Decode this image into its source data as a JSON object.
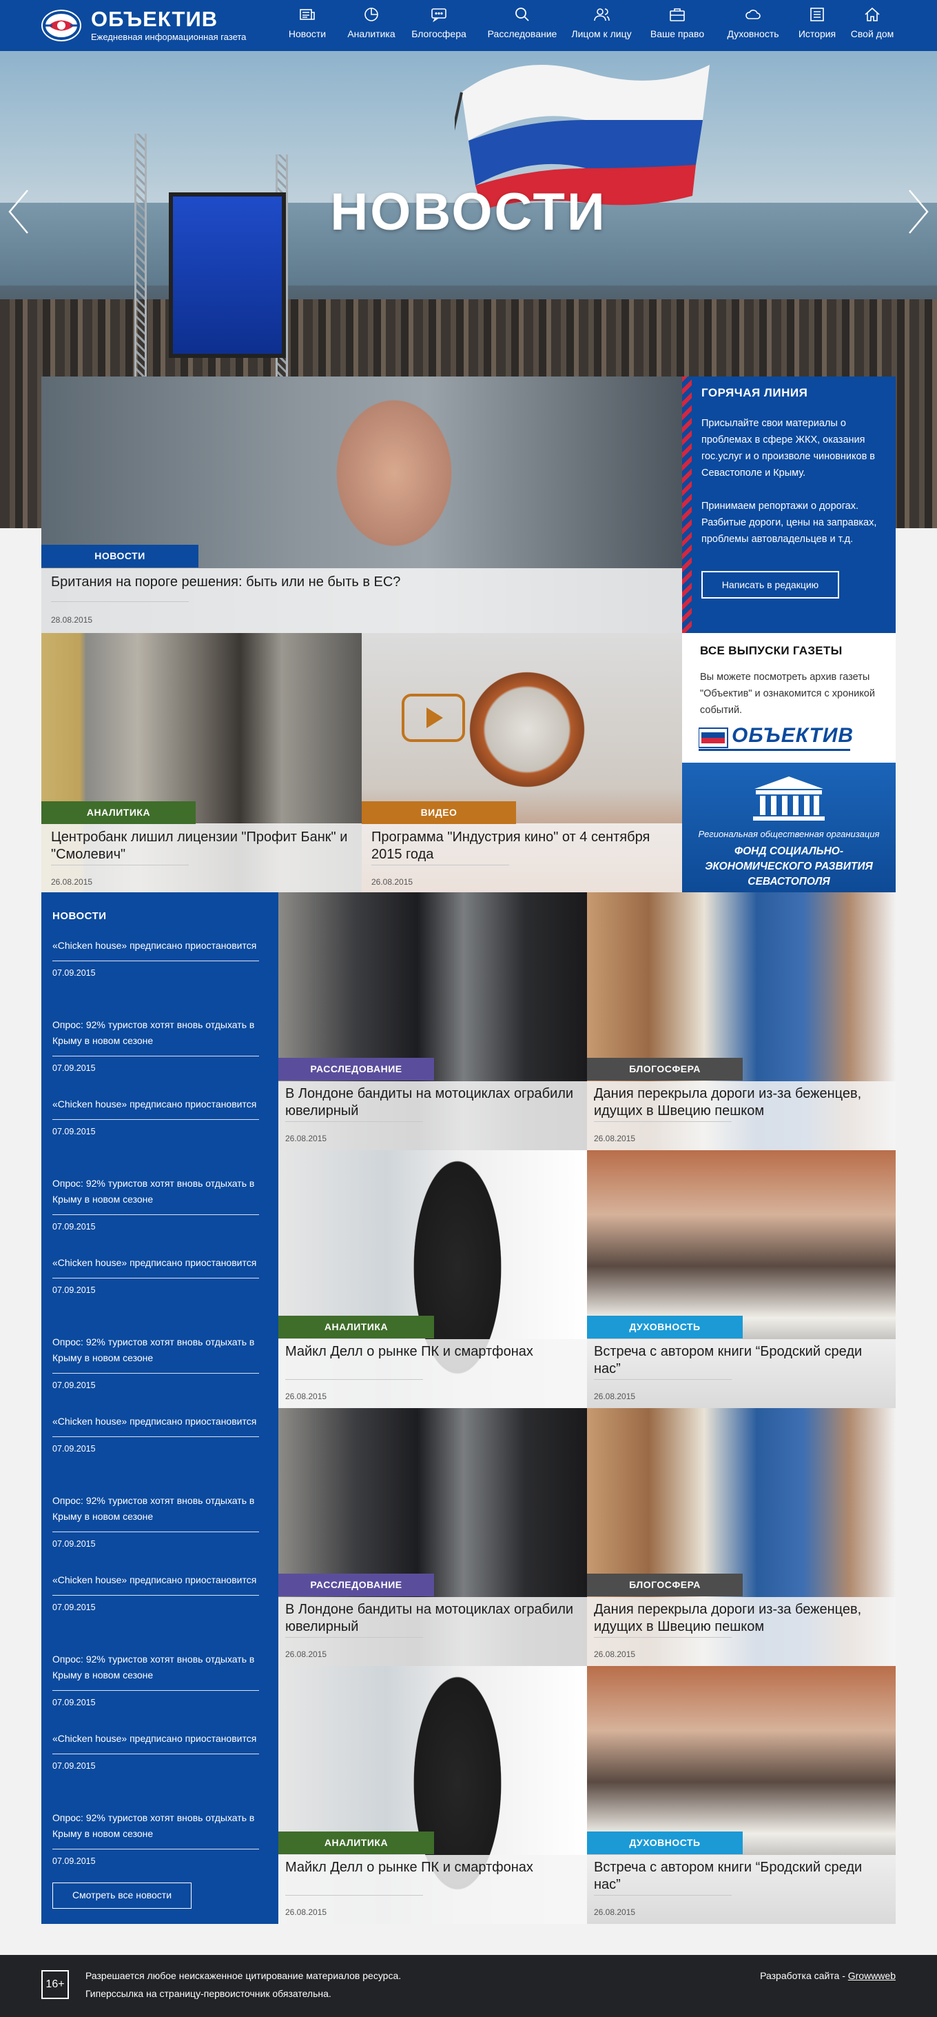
{
  "header": {
    "logo_name": "ОБЪЕКТИВ",
    "logo_tagline": "Ежедневная информационная газета",
    "nav": [
      {
        "label": "Новости",
        "icon": "news-icon"
      },
      {
        "label": "Аналитика",
        "icon": "pie-chart-icon"
      },
      {
        "label": "Блогосфера",
        "icon": "chat-icon"
      },
      {
        "label": "Расследование",
        "icon": "search-icon"
      },
      {
        "label": "Лицом к лицу",
        "icon": "users-icon"
      },
      {
        "label": "Ваше право",
        "icon": "briefcase-icon"
      },
      {
        "label": "Духовность",
        "icon": "cloud-icon"
      },
      {
        "label": "История",
        "icon": "book-icon"
      },
      {
        "label": "Свой дом",
        "icon": "home-icon"
      }
    ]
  },
  "hero": {
    "title": "НОВОСТИ"
  },
  "featured": {
    "badge": "НОВОСТИ",
    "title": "Британия на пороге решения: быть или не быть в ЕС?",
    "date": "28.08.2015"
  },
  "hotline": {
    "title": "ГОРЯЧАЯ ЛИНИЯ",
    "text1": "Присылайте свои материалы о проблемах в сфере ЖКХ, оказания гос.услуг и о произволе чиновников в Севастополе и Крыму.",
    "text2": "Принимаем репортажи о дорогах. Разбитые дороги, цены на заправках, проблемы автовладельцев и т.д.",
    "button": "Написать в редакцию"
  },
  "archive": {
    "title": "ВСЕ ВЫПУСКИ ГАЗЕТЫ",
    "text": "Вы можете посмотреть архив газеты \"Объектив\" и ознакомится с хроникой событий.",
    "logo_text": "ОБЪЕКТИВ"
  },
  "fond": {
    "line1": "Региональная общественная организация",
    "line2": "ФОНД СОЦИАЛЬНО-ЭКОНОМИЧЕСКОГО РАЗВИТИЯ СЕВАСТОПОЛЯ"
  },
  "row2": [
    {
      "badge": "АНАЛИТИКА",
      "title": "Центробанк лишил лицензии \"Профит Банк\" и \"Смолевич\"",
      "date": "26.08.2015"
    },
    {
      "badge": "ВИДЕО",
      "title": "Программа \"Индустрия кино\" от 4 сентября 2015 года",
      "date": "26.08.2015"
    }
  ],
  "grid": [
    {
      "badge": "РАССЛЕДОВАНИЕ",
      "title": "В Лондоне бандиты на мотоциклах ограбили ювелирный",
      "date": "26.08.2015"
    },
    {
      "badge": "БЛОГОСФЕРА",
      "title": "Дания перекрыла дороги из-за беженцев, идущих в Швецию пешком",
      "date": "26.08.2015"
    },
    {
      "badge": "АНАЛИТИКА",
      "title": "Майкл Делл о рынке ПК и смартфонах",
      "date": "26.08.2015"
    },
    {
      "badge": "ДУХОВНОСТЬ",
      "title": "Встреча с автором книги “Бродский среди нас”",
      "date": "26.08.2015"
    },
    {
      "badge": "РАССЛЕДОВАНИЕ",
      "title": "В Лондоне бандиты на мотоциклах ограбили ювелирный",
      "date": "26.08.2015"
    },
    {
      "badge": "БЛОГОСФЕРА",
      "title": "Дания перекрыла дороги из-за беженцев, идущих в Швецию пешком",
      "date": "26.08.2015"
    },
    {
      "badge": "АНАЛИТИКА",
      "title": "Майкл Делл о рынке ПК и смартфонах",
      "date": "26.08.2015"
    },
    {
      "badge": "ДУХОВНОСТЬ",
      "title": "Встреча с автором книги “Бродский среди нас”",
      "date": "26.08.2015"
    }
  ],
  "newslist": {
    "title": "НОВОСТИ",
    "items": [
      {
        "title": "«Chicken house» предписано приостановится",
        "date": "07.09.2015"
      },
      {
        "title": "Опрос: 92% туристов хотят вновь отдыхать в Крыму в новом сезоне",
        "date": "07.09.2015"
      },
      {
        "title": "«Chicken house» предписано приостановится",
        "date": "07.09.2015"
      },
      {
        "title": "Опрос: 92% туристов хотят вновь отдыхать в Крыму в новом сезоне",
        "date": "07.09.2015"
      },
      {
        "title": "«Chicken house» предписано приостановится",
        "date": "07.09.2015"
      },
      {
        "title": "Опрос: 92% туристов хотят вновь отдыхать в Крыму в новом сезоне",
        "date": "07.09.2015"
      },
      {
        "title": "«Chicken house» предписано приостановится",
        "date": "07.09.2015"
      },
      {
        "title": "Опрос: 92% туристов хотят вновь отдыхать в Крыму в новом сезоне",
        "date": "07.09.2015"
      },
      {
        "title": "«Chicken house» предписано приостановится",
        "date": "07.09.2015"
      },
      {
        "title": "Опрос: 92% туристов хотят вновь отдыхать в Крыму в новом сезоне",
        "date": "07.09.2015"
      },
      {
        "title": "«Chicken house» предписано приостановится",
        "date": "07.09.2015"
      },
      {
        "title": "Опрос: 92% туристов хотят вновь отдыхать в Крыму в новом сезоне",
        "date": "07.09.2015"
      }
    ],
    "more_button": "Смотреть все новости"
  },
  "footer": {
    "age": "16+",
    "line1": "Разрешается любое неискаженное цитирование материалов ресурса.",
    "line2": "Гиперссылка на страницу-первоисточник обязательна.",
    "dev_prefix": "Разработка сайта - ",
    "dev_link": "Growwweb"
  },
  "colors": {
    "brand_blue": "#0b4a9e",
    "news": "#0b4a9e",
    "analytics": "#3f6d2a",
    "video": "#c0741d",
    "investigation": "#5a4e9c",
    "blogs": "#4d4d4d",
    "spirituality": "#1b9ad6",
    "hotline_stripe": "#d7263d",
    "footer": "#222326"
  }
}
